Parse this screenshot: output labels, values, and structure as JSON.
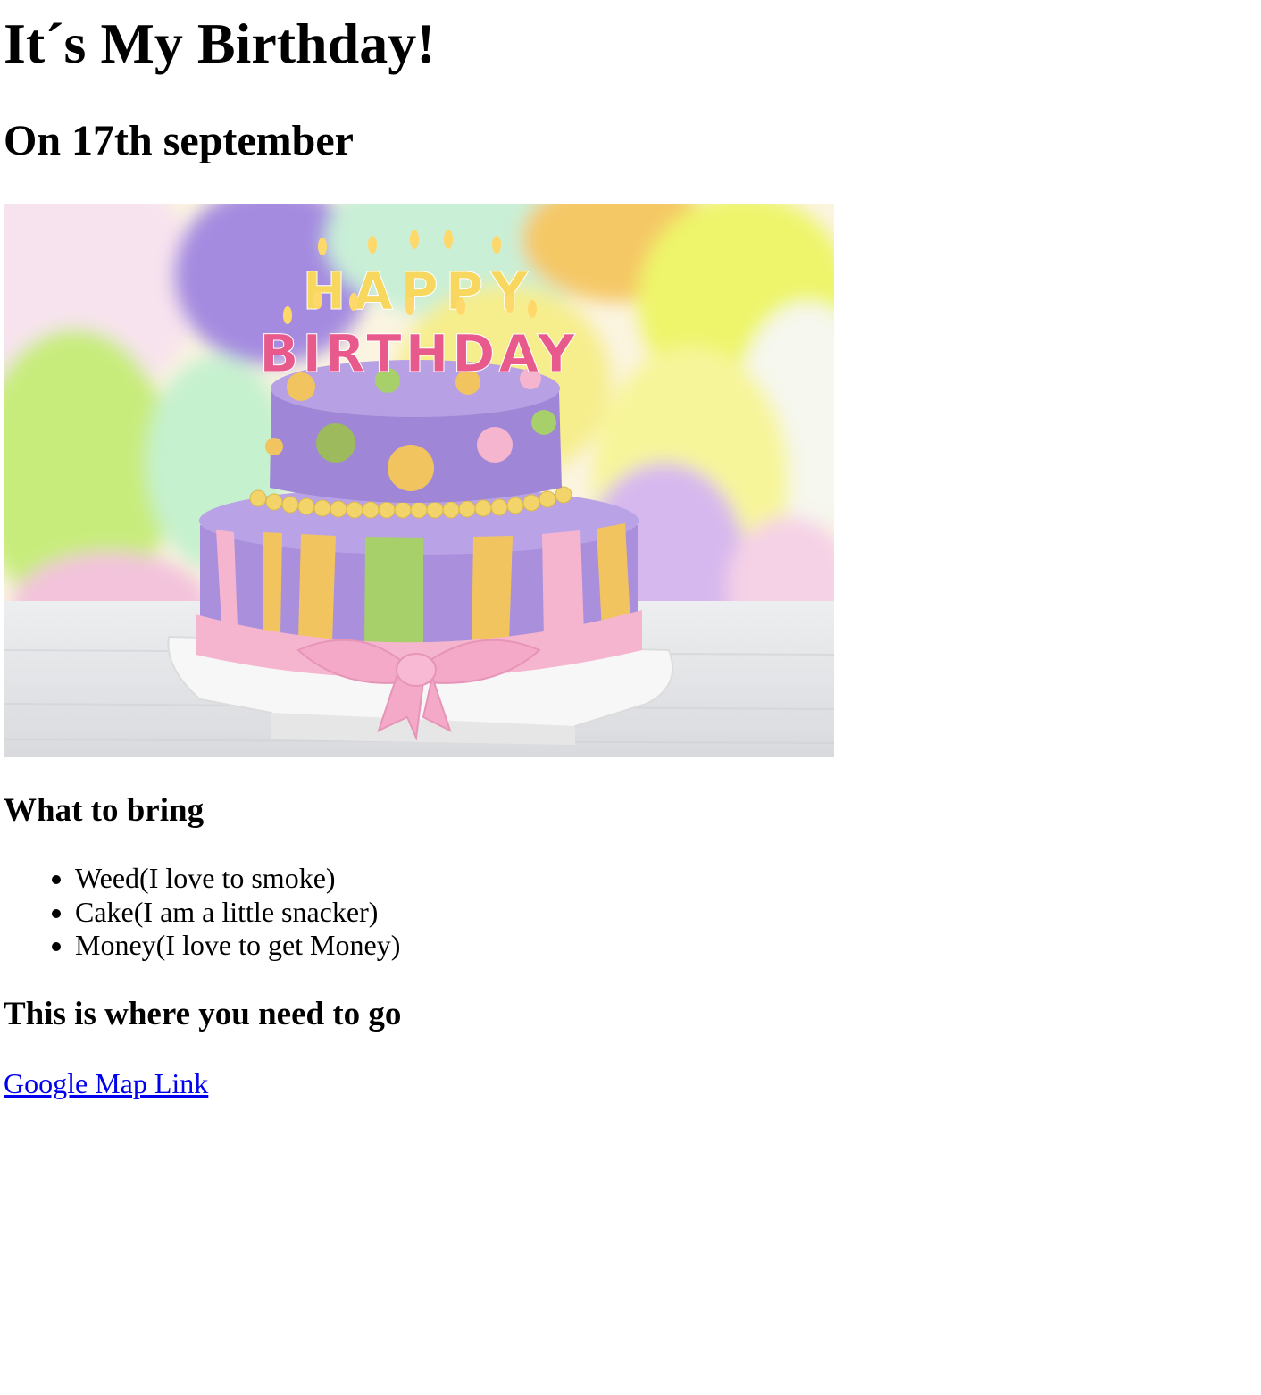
{
  "page": {
    "title": "It´s My Birthday!",
    "date_heading": "On 17th september"
  },
  "image": {
    "alt": "",
    "topper_word_1": "HAPPY",
    "topper_word_2": "BIRTHDAY",
    "colors": {
      "lilac": "#a98fdc",
      "yellow": "#f2c45f",
      "green": "#a7cf6a",
      "pink": "#f6b5cf",
      "board": "#f4f4f4"
    }
  },
  "bring": {
    "heading": "What to bring",
    "items": [
      "Weed(I love to smoke)",
      "Cake(I am a little snacker)",
      "Money(I love to get Money)"
    ]
  },
  "location": {
    "heading": "This is where you need to go",
    "link_label": "Google Map Link"
  },
  "theme": {
    "link_color": "#0000ee",
    "text_color": "#000000"
  }
}
